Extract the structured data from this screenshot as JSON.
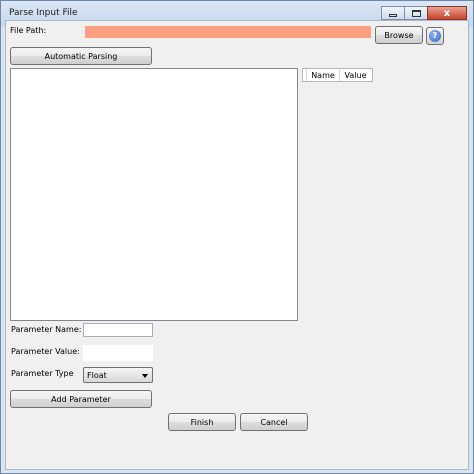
{
  "window": {
    "title": "Parse Input File",
    "close_glyph": "x"
  },
  "file_path": {
    "label": "File Path:",
    "value": "",
    "invalid_color": "#fca081"
  },
  "buttons": {
    "browse": "Browse",
    "automatic_parsing": "Automatic Parsing",
    "add_parameter": "Add Parameter",
    "finish": "Finish",
    "cancel": "Cancel",
    "help_glyph": "?"
  },
  "parameters_table": {
    "columns": [
      "Name",
      "Value"
    ],
    "rows": []
  },
  "form": {
    "parameter_name_label": "Parameter Name:",
    "parameter_name_value": "",
    "parameter_value_label": "Parameter Value:",
    "parameter_value_value": "",
    "parameter_type_label": "Parameter Type",
    "parameter_type_selected": "Float"
  },
  "icons": {
    "help": "help-icon",
    "dropdown": "chevron-down-icon",
    "minimize": "minimize-icon",
    "maximize": "maximize-icon",
    "close": "close-icon"
  }
}
